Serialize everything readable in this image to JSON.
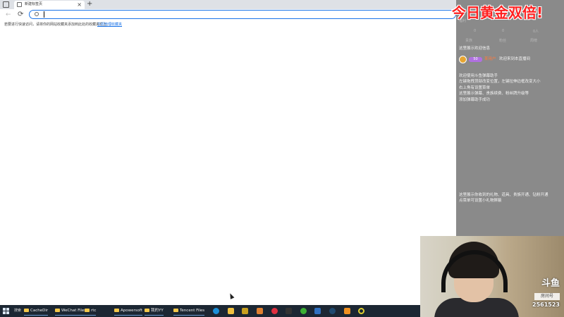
{
  "browser": {
    "tab": {
      "title": "新建标签页",
      "close": "×"
    },
    "new_tab": "+",
    "back": "←",
    "reload": "⟳",
    "address_value": "",
    "bookmark_hint": "若要进行快速访问，请将你的网站收藏夹添加到此处的收藏夹栏上。",
    "bookmark_link": "立即管理收藏夹"
  },
  "banner": "今日黄金双倍!",
  "panel": {
    "faint_top": "福利",
    "faint_row1": [
      "0",
      "0",
      "0人"
    ],
    "faint_row2": [
      "贵族",
      "粉丝",
      "周榜"
    ],
    "notice_1": "这里展示欢迎信息",
    "user": {
      "level": "50",
      "name": "某用户",
      "message": "欢迎来到本直播间"
    },
    "help_lines": [
      "欢迎使用斗鱼弹幕助手",
      "左键拖拽顶部改变位置，左键拉伸边框改变大小",
      "右上角有设置菜单",
      "这里展示弹幕、贵族续费、粉丝牌升级等",
      "添加弹幕助手成功"
    ],
    "gift_lines": [
      "这里展示你收到的礼物、道具、贵族开通、钻粉开通",
      "点菜单可设置小礼物屏蔽"
    ]
  },
  "webcam": {
    "logo": "斗鱼",
    "label": "房间号",
    "room_number": "2561523"
  },
  "taskbar": {
    "search_label": "搜索",
    "items": [
      "CacheDir",
      "WeChat Files",
      "rtc",
      "Apowersoft",
      "我的YY",
      "Tencent Files"
    ]
  },
  "colors": {
    "accent": "#1a73e8",
    "banner": "#ff2020",
    "panel_bg": "#8a8a8a",
    "taskbar_bg": "#1c2733"
  }
}
